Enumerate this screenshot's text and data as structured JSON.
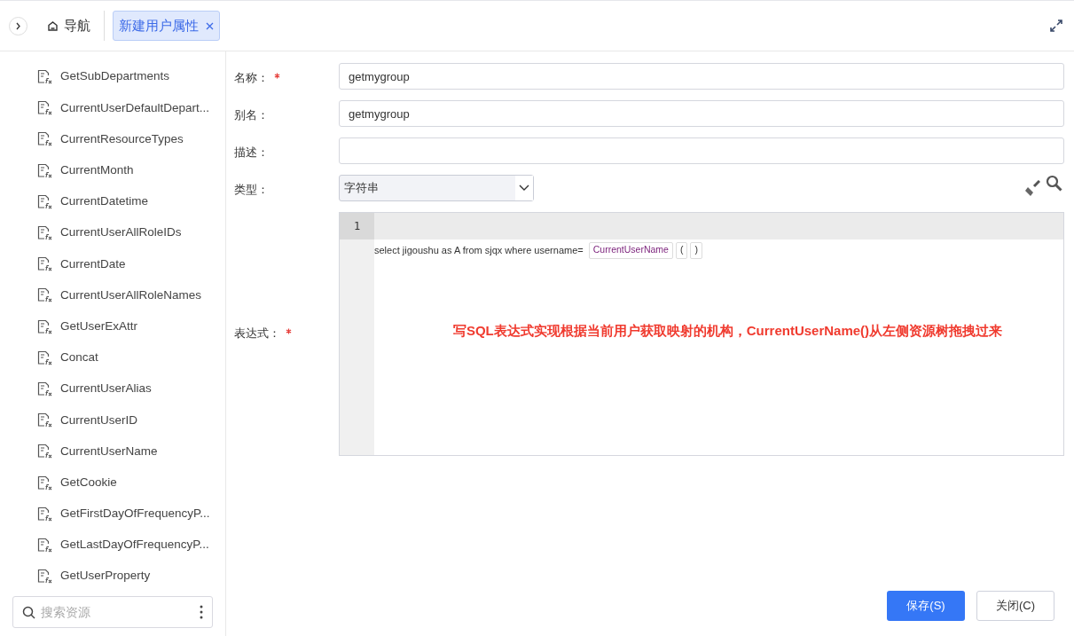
{
  "tabs": [
    {
      "kind": "home",
      "label": "导航",
      "selected": false,
      "closable": false
    },
    {
      "kind": "page",
      "label": "新建用户属性",
      "selected": true,
      "closable": true
    }
  ],
  "sidebar": {
    "items": [
      {
        "label": "GetSubDepartments"
      },
      {
        "label": "CurrentUserDefaultDepart..."
      },
      {
        "label": "CurrentResourceTypes"
      },
      {
        "label": "CurrentMonth"
      },
      {
        "label": "CurrentDatetime"
      },
      {
        "label": "CurrentUserAllRoleIDs"
      },
      {
        "label": "CurrentDate"
      },
      {
        "label": "CurrentUserAllRoleNames"
      },
      {
        "label": "GetUserExAttr"
      },
      {
        "label": "Concat"
      },
      {
        "label": "CurrentUserAlias"
      },
      {
        "label": "CurrentUserID"
      },
      {
        "label": "CurrentUserName"
      },
      {
        "label": "GetCookie"
      },
      {
        "label": "GetFirstDayOfFrequencyP..."
      },
      {
        "label": "GetLastDayOfFrequencyP..."
      },
      {
        "label": "GetUserProperty"
      }
    ],
    "search": {
      "placeholder": "搜索资源"
    }
  },
  "form": {
    "fields": [
      {
        "label": "名称：",
        "required": true,
        "kind": "text",
        "value": "getmygroup"
      },
      {
        "label": "别名：",
        "required": false,
        "kind": "text",
        "value": "getmygroup"
      },
      {
        "label": "描述：",
        "required": false,
        "kind": "text"
      },
      {
        "label": "类型：",
        "required": false,
        "kind": "select",
        "value": "字符串"
      }
    ],
    "expression": {
      "label": "表达式：",
      "required": true,
      "line_number": "1",
      "code": "select jigoushu as A from sjqx where username=",
      "tokens": [
        "CurrentUserName",
        "(",
        ")"
      ],
      "annotation": "写SQL表达式实现根据当前用户获取映射的机构，CurrentUserName()从左侧资源树拖拽过来"
    }
  },
  "buttons": [
    {
      "kind": "primary",
      "label": "保存(S)"
    },
    {
      "kind": "default",
      "label": "关闭(C)"
    }
  ]
}
